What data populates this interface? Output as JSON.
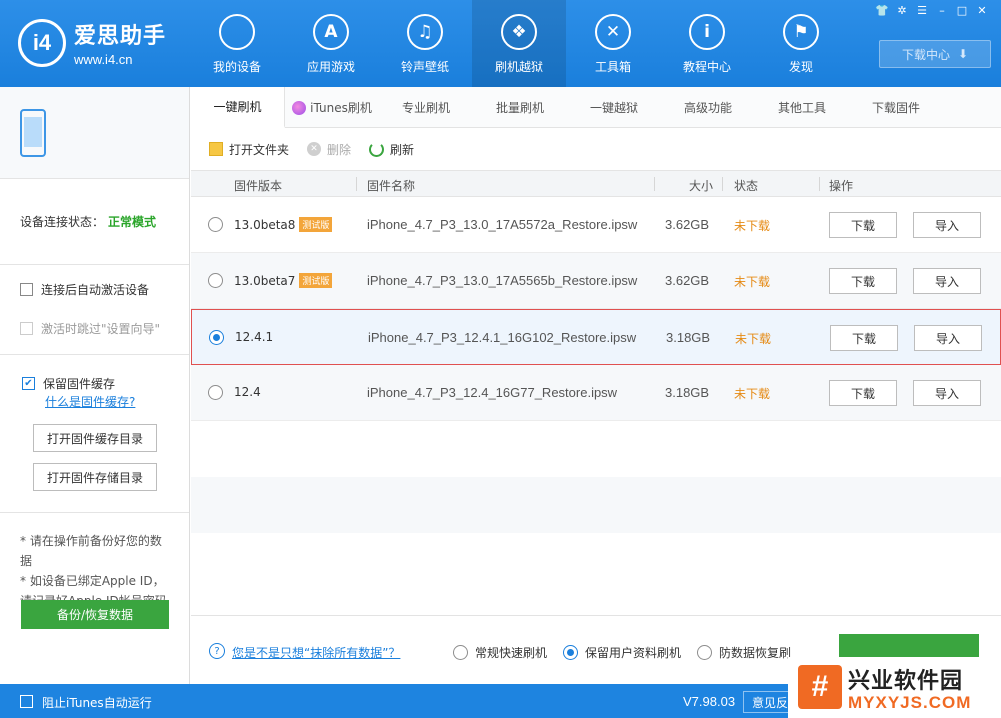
{
  "app": {
    "logo_mark": "i4",
    "name": "爱思助手",
    "url": "www.i4.cn"
  },
  "nav": [
    {
      "label": "我的设备",
      "icon": "apple-icon",
      "glyph": "",
      "active": false
    },
    {
      "label": "应用游戏",
      "icon": "app-store-icon",
      "glyph": "A",
      "active": false
    },
    {
      "label": "铃声壁纸",
      "icon": "music-icon",
      "glyph": "♫",
      "active": false
    },
    {
      "label": "刷机越狱",
      "icon": "dropbox-icon",
      "glyph": "❖",
      "active": true
    },
    {
      "label": "工具箱",
      "icon": "tools-icon",
      "glyph": "✕",
      "active": false
    },
    {
      "label": "教程中心",
      "icon": "info-icon",
      "glyph": "i",
      "active": false
    },
    {
      "label": "发现",
      "icon": "flag-icon",
      "glyph": "⚑",
      "active": false
    }
  ],
  "window": {
    "controls": [
      "shirt-icon",
      "gear-icon",
      "menu-icon",
      "minimize-icon",
      "maximize-icon",
      "close-icon"
    ],
    "download_center": "下载中心"
  },
  "sidebar": {
    "conn_label": "设备连接状态：",
    "conn_value": "正常模式",
    "auto_activate": "连接后自动激活设备",
    "skip_wizard": "激活时跳过\"设置向导\"",
    "keep_cache": "保留固件缓存",
    "what_cache": "什么是固件缓存?",
    "open_cache_dir": "打开固件缓存目录",
    "open_store_dir": "打开固件存储目录",
    "note1": "* 请在操作前备份好您的数据",
    "note2": "* 如设备已绑定Apple ID，请记录好Apple ID帐号密码",
    "backup_button": "备份/恢复数据"
  },
  "tabs": [
    {
      "label": "一键刷机",
      "active": true
    },
    {
      "label": "iTunes刷机",
      "active": false
    },
    {
      "label": "专业刷机",
      "active": false
    },
    {
      "label": "批量刷机",
      "active": false
    },
    {
      "label": "一键越狱",
      "active": false
    },
    {
      "label": "高级功能",
      "active": false
    },
    {
      "label": "其他工具",
      "active": false
    },
    {
      "label": "下载固件",
      "active": false
    }
  ],
  "toolbar": {
    "open_folder": "打开文件夹",
    "delete": "删除",
    "refresh": "刷新"
  },
  "table": {
    "headers": [
      "固件版本",
      "固件名称",
      "大小",
      "状态",
      "操作"
    ],
    "rows": [
      {
        "version": "13.0beta8",
        "tag": "测试版",
        "name": "iPhone_4.7_P3_13.0_17A5572a_Restore.ipsw",
        "size": "3.62GB",
        "status": "未下载",
        "download": "下载",
        "import": "导入",
        "selected": false
      },
      {
        "version": "13.0beta7",
        "tag": "测试版",
        "name": "iPhone_4.7_P3_13.0_17A5565b_Restore.ipsw",
        "size": "3.62GB",
        "status": "未下载",
        "download": "下载",
        "import": "导入",
        "selected": false
      },
      {
        "version": "12.4.1",
        "tag": "",
        "name": "iPhone_4.7_P3_12.4.1_16G102_Restore.ipsw",
        "size": "3.18GB",
        "status": "未下载",
        "download": "下载",
        "import": "导入",
        "selected": true
      },
      {
        "version": "12.4",
        "tag": "",
        "name": "iPhone_4.7_P3_12.4_16G77_Restore.ipsw",
        "size": "3.18GB",
        "status": "未下载",
        "download": "下载",
        "import": "导入",
        "selected": false
      }
    ]
  },
  "bottom": {
    "question": "您是不是只想“抹除所有数据”？",
    "mode_normal": "常规快速刷机",
    "mode_keep": "保留用户资料刷机",
    "mode_anti": "防数据恢复刷"
  },
  "statusbar": {
    "block_itunes": "阻止iTunes自动运行",
    "version": "V7.98.03",
    "feedback": "意见反"
  },
  "watermark": {
    "logo": "#",
    "name": "兴业软件园",
    "url": "MYXYJS.COM"
  }
}
